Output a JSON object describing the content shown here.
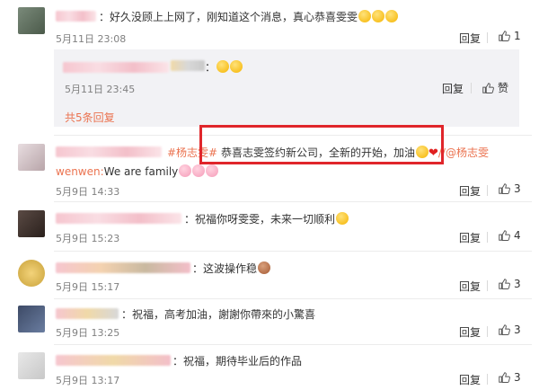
{
  "comments": [
    {
      "text": "：好久没顾上上网了，刚知道这个消息，真心恭喜雯雯",
      "time": "5月11日 23:08",
      "reply": "回复",
      "likes": "1"
    },
    {
      "text": "：",
      "time": "5月11日 23:45",
      "reply": "回复",
      "likes": "赞"
    },
    {
      "text_tag": "#杨志雯#",
      "text_main": " 恭喜志雯签约新公司，全新的开始，加油",
      "mention": "//@杨志雯",
      "text_line2_prefix": "wenwen:",
      "text_line2": "We are family",
      "time": "5月9日 14:33",
      "reply": "回复",
      "likes": "3"
    },
    {
      "text": "：祝福你呀雯雯，未来一切顺利",
      "time": "5月9日 15:23",
      "reply": "回复",
      "likes": "4"
    },
    {
      "text": "：这波操作稳",
      "time": "5月9日 15:17",
      "reply": "回复",
      "likes": "3"
    },
    {
      "text": "：祝福，高考加油，謝謝你帶來的小驚喜",
      "time": "5月9日 13:25",
      "reply": "回复",
      "likes": "3"
    },
    {
      "text": "：祝福，期待毕业后的作品",
      "time": "5月9日 13:17",
      "reply": "回复",
      "likes": "3"
    }
  ],
  "more_replies": "共5条回复",
  "colors": {
    "link": "#eb7350",
    "highlight_box": "#e0262b"
  },
  "icons": {
    "like": "thumbs-up-icon"
  }
}
